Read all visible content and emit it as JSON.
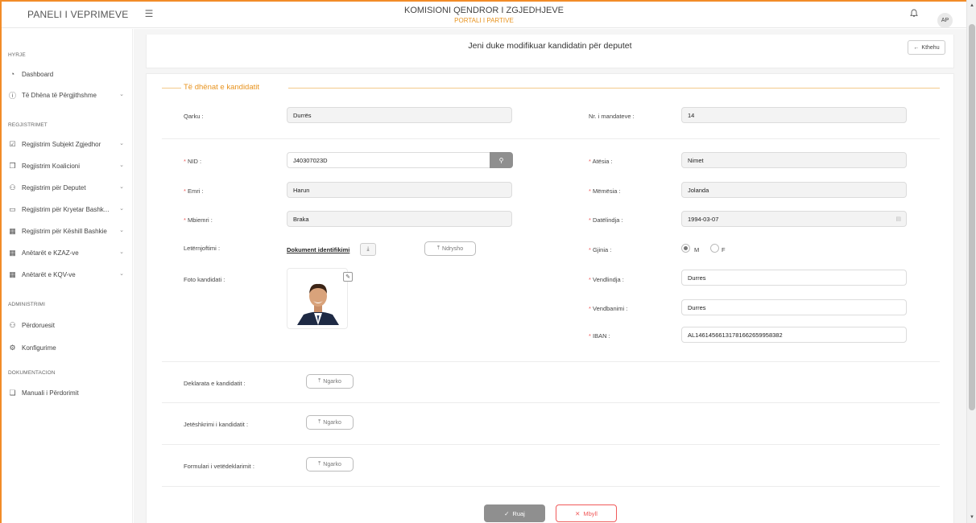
{
  "header": {
    "app_title": "PANELI I VEPRIMEVE",
    "org_title": "KOMISIONI QENDROR I ZGJEDHJEVE",
    "org_subtitle": "PORTALI I PARTIVE",
    "avatar_initials": "AP"
  },
  "sidebar": {
    "sections": [
      {
        "title": "HYRJE"
      },
      {
        "title": "REGJISTRIMET"
      },
      {
        "title": "ADMINISTRIMI"
      },
      {
        "title": "DOKUMENTACION"
      }
    ],
    "items": [
      {
        "label": "Dashboard",
        "icon": "dashboard-icon"
      },
      {
        "label": "Të Dhëna të Përgjithshme",
        "icon": "info-icon"
      },
      {
        "label": "Regjistrim Subjekt Zgjedhor",
        "icon": "form-icon"
      },
      {
        "label": "Regjistrim Koalicioni",
        "icon": "document-icon"
      },
      {
        "label": "Regjistrim për Deputet",
        "icon": "users-icon"
      },
      {
        "label": "Regjistrim për Kryetar Bashk...",
        "icon": "id-card-icon"
      },
      {
        "label": "Regjistrim për Këshill Bashkie",
        "icon": "building-icon"
      },
      {
        "label": "Anëtarët e KZAZ-ve",
        "icon": "building-icon"
      },
      {
        "label": "Anëtarët e KQV-ve",
        "icon": "building-icon"
      },
      {
        "label": "Përdoruesit",
        "icon": "users-icon"
      },
      {
        "label": "Konfigurime",
        "icon": "gear-icon"
      },
      {
        "label": "Manuali i Përdorimit",
        "icon": "document-icon"
      }
    ]
  },
  "page": {
    "title": "Jeni duke modifikuar kandidatin për deputet",
    "back_label": "Kthehu"
  },
  "form": {
    "section_title": "Të dhënat e kandidatit",
    "qarku": {
      "label": "Qarku",
      "value": "Durrës"
    },
    "mandates": {
      "label": "Nr. i mandateve",
      "value": "14"
    },
    "nid": {
      "label": "NID",
      "value": "J40307023D"
    },
    "atesia": {
      "label": "Atësia",
      "value": "Nimet"
    },
    "emri": {
      "label": "Emri",
      "value": "Harun"
    },
    "memesia": {
      "label": "Mëmësia",
      "value": "Jolanda"
    },
    "mbiemri": {
      "label": "Mbiemri",
      "value": "Braka"
    },
    "datelindja": {
      "label": "Datëlindja",
      "value": "1994-03-07"
    },
    "letternjoftimi": {
      "label": "Letërnjoftimi",
      "link": "Dokument identifikimi",
      "change_label": "Ndrysho"
    },
    "gjinia": {
      "label": "Gjinia",
      "options": [
        "M",
        "F"
      ],
      "selected": "M"
    },
    "foto": {
      "label": "Foto kandidati"
    },
    "vendlindja": {
      "label": "Vendlindja",
      "value": "Durres"
    },
    "vendbanimi": {
      "label": "Vendbanimi",
      "value": "Durres"
    },
    "iban": {
      "label": "IBAN",
      "value": "AL14614566131781662659958382"
    },
    "deklarata": {
      "label": "Deklarata e kandidatit",
      "button": "Ngarko"
    },
    "jeteshkrimi": {
      "label": "Jetëshkrimi i kandidatit",
      "button": "Ngarko"
    },
    "formulari": {
      "label": "Formulari i vetëdeklarimit",
      "button": "Ngarko"
    },
    "save_label": "Ruaj",
    "close_label": "Mbyll"
  }
}
